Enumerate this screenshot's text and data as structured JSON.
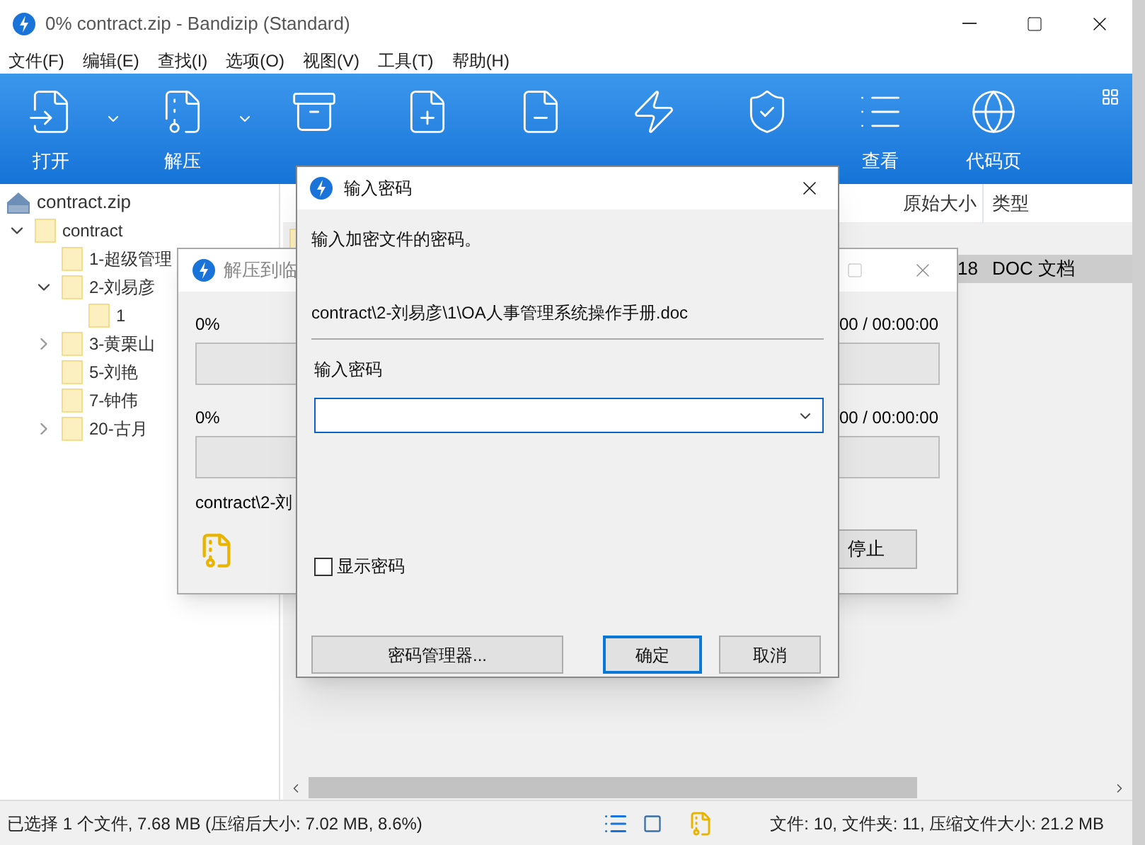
{
  "window": {
    "title": "0% contract.zip - Bandizip (Standard)"
  },
  "menu": [
    "文件(F)",
    "编辑(E)",
    "查找(I)",
    "选项(O)",
    "视图(V)",
    "工具(T)",
    "帮助(H)"
  ],
  "toolbar": [
    {
      "label": "打开",
      "kind": "open",
      "has_menu": true
    },
    {
      "label": "解压",
      "kind": "extract",
      "has_menu": true
    },
    {
      "kind": "new",
      "has_menu": false
    },
    {
      "kind": "add",
      "has_menu": false
    },
    {
      "kind": "delete",
      "has_menu": false
    },
    {
      "kind": "test",
      "has_menu": false
    },
    {
      "kind": "scan",
      "has_menu": false
    },
    {
      "label": "查看",
      "kind": "view",
      "has_menu": false
    },
    {
      "label": "代码页",
      "kind": "codepage",
      "has_menu": false
    }
  ],
  "tree": {
    "label": "contract.zip",
    "children": [
      {
        "label": "contract",
        "expanded": true,
        "children": [
          {
            "label": "1-超级管理"
          },
          {
            "label": "2-刘易彦",
            "expanded": true,
            "children": [
              {
                "label": "1"
              }
            ]
          },
          {
            "label": "3-黄栗山",
            "expanded": false
          },
          {
            "label": "5-刘艳"
          },
          {
            "label": "7-钟伟"
          },
          {
            "label": "20-古月",
            "expanded": false
          }
        ]
      }
    ]
  },
  "file_list": {
    "columns": [
      "原始大小",
      "类型"
    ],
    "rows": [
      {
        "cells": [
          "",
          ""
        ],
        "selected": false
      },
      {
        "cells": [
          "18",
          "DOC 文档"
        ],
        "selected": true
      }
    ]
  },
  "status_bar": {
    "left": "已选择 1 个文件, 7.68 MB (压缩后大小: 7.02 MB, 8.6%)",
    "right": "文件: 10, 文件夹: 11, 压缩文件大小: 21.2 MB"
  },
  "progress_dialog": {
    "title": "解压到临",
    "rows": [
      {
        "percent": "0%",
        "time": "00 / 00:00:00",
        "level": 0
      },
      {
        "percent": "0%",
        "time": "00 / 00:00:00",
        "level": 0
      }
    ],
    "path": "contract\\2-刘",
    "stop": "停止"
  },
  "password_dialog": {
    "title": "输入密码",
    "prompt": "输入加密文件的密码。",
    "path": "contract\\2-刘易彦\\1\\OA人事管理系统操作手册.doc",
    "field_label": "输入密码",
    "show_password": {
      "label": "显示密码",
      "checked": false
    },
    "buttons": [
      {
        "label": "密码管理器...",
        "default": false
      },
      {
        "label": "确定",
        "default": true
      },
      {
        "label": "取消",
        "default": false
      }
    ]
  }
}
